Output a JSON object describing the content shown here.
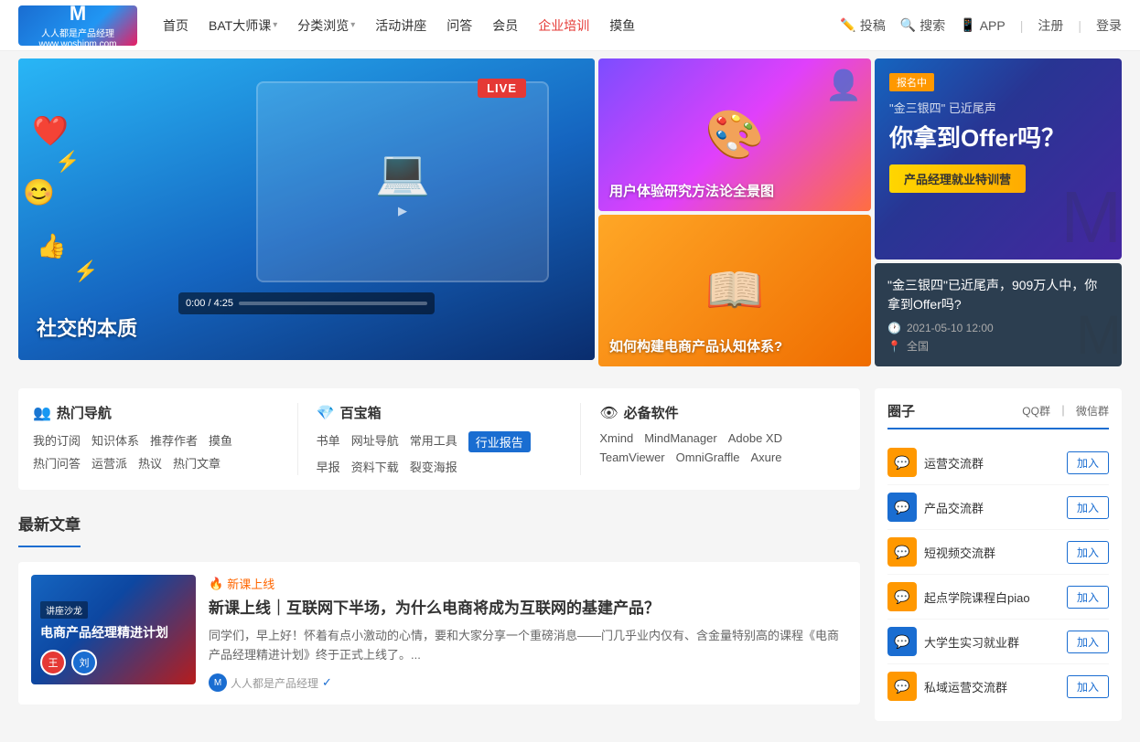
{
  "site": {
    "logo_m": "M",
    "logo_text": "www.woshipm.com",
    "logo_tagline": "人人都是产品经理"
  },
  "nav": {
    "items": [
      {
        "label": "首页",
        "active": false,
        "hasDropdown": false
      },
      {
        "label": "BAT大师课",
        "active": false,
        "hasDropdown": true
      },
      {
        "label": "分类浏览",
        "active": false,
        "hasDropdown": true
      },
      {
        "label": "活动讲座",
        "active": false,
        "hasDropdown": false
      },
      {
        "label": "问答",
        "active": false,
        "hasDropdown": false
      },
      {
        "label": "会员",
        "active": false,
        "hasDropdown": false
      },
      {
        "label": "企业培训",
        "active": true,
        "hasDropdown": false
      },
      {
        "label": "摸鱼",
        "active": false,
        "hasDropdown": false
      }
    ],
    "right": [
      {
        "label": "投稿",
        "icon": "✏️"
      },
      {
        "label": "搜索",
        "icon": "🔍"
      },
      {
        "label": "APP",
        "icon": "📱"
      }
    ],
    "auth": [
      "注册",
      "登录"
    ]
  },
  "hero": {
    "main": {
      "title": "社交的本质",
      "live_badge": "LIVE",
      "video_time": "0:00 / 4:25"
    },
    "cards": [
      {
        "label": "用户体验研究方法论全景图",
        "position": "top"
      },
      {
        "label": "如何构建电商产品认知体系?",
        "position": "bottom"
      }
    ],
    "promo": {
      "badge": "报名中",
      "subtitle": "\"金三银四\" 已近尾声",
      "title": "你拿到Offer吗？",
      "btn_label": "产品经理就业特训营",
      "event_title": "\"金三银四\"已近尾声，909万人中，你拿到Offer吗?",
      "event_time": "2021-05-10 12:00",
      "event_location": "全国"
    }
  },
  "hot_nav": {
    "title": "热门导航",
    "icon": "👥",
    "links": [
      {
        "label": "我的订阅",
        "highlight": false
      },
      {
        "label": "知识体系",
        "highlight": false
      },
      {
        "label": "推荐作者",
        "highlight": false
      },
      {
        "label": "摸鱼",
        "highlight": false
      },
      {
        "label": "热门问答",
        "highlight": false
      },
      {
        "label": "运营派",
        "highlight": false
      },
      {
        "label": "热议",
        "highlight": false
      },
      {
        "label": "热门文章",
        "highlight": false
      }
    ]
  },
  "baobao": {
    "title": "百宝箱",
    "icon": "💎",
    "links": [
      {
        "label": "书单",
        "highlight": false
      },
      {
        "label": "网址导航",
        "highlight": false
      },
      {
        "label": "常用工具",
        "highlight": false
      },
      {
        "label": "行业报告",
        "highlight": true
      },
      {
        "label": "早报",
        "highlight": false
      },
      {
        "label": "资料下载",
        "highlight": false
      },
      {
        "label": "裂变海报",
        "highlight": false
      }
    ]
  },
  "software": {
    "title": "必备软件",
    "icon": "👁",
    "links": [
      {
        "label": "Xmind"
      },
      {
        "label": "MindManager"
      },
      {
        "label": "Adobe XD"
      },
      {
        "label": "TeamViewer"
      },
      {
        "label": "OmniGraffle"
      },
      {
        "label": "Axure"
      }
    ]
  },
  "latest_articles": {
    "section_title": "最新文章",
    "items": [
      {
        "thumb_tag": "讲座沙龙",
        "thumb_title": "电商产品经理精进计划",
        "tag_icon": "🔥",
        "tag": "新课上线",
        "title": "新课上线｜互联网下半场，为什么电商将成为互联网的基建产品？",
        "excerpt": "同学们，早上好！怀着有点小激动的心情，要和大家分享一个重磅消息——门几乎业内仅有、含金量特别高的课程《电商产品经理精进计划》终于正式上线了。...",
        "author": "人人都是产品经理",
        "author_icon": "M",
        "author_verified": true
      }
    ]
  },
  "sidebar": {
    "title": "圈子",
    "links": [
      "QQ群",
      "微信群"
    ],
    "groups": [
      {
        "name": "运营交流群",
        "color": "#ff9800",
        "emoji": "💬"
      },
      {
        "name": "产品交流群",
        "color": "#1a6dd1",
        "emoji": "💬"
      },
      {
        "name": "短视频交流群",
        "color": "#ff9800",
        "emoji": "💬"
      },
      {
        "name": "起点学院课程白piao",
        "color": "#ff9800",
        "emoji": "💬"
      },
      {
        "name": "大学生实习就业群",
        "color": "#1a6dd1",
        "emoji": "💬"
      },
      {
        "name": "私域运营交流群",
        "color": "#ff9800",
        "emoji": "💬"
      }
    ],
    "join_label": "加入"
  }
}
